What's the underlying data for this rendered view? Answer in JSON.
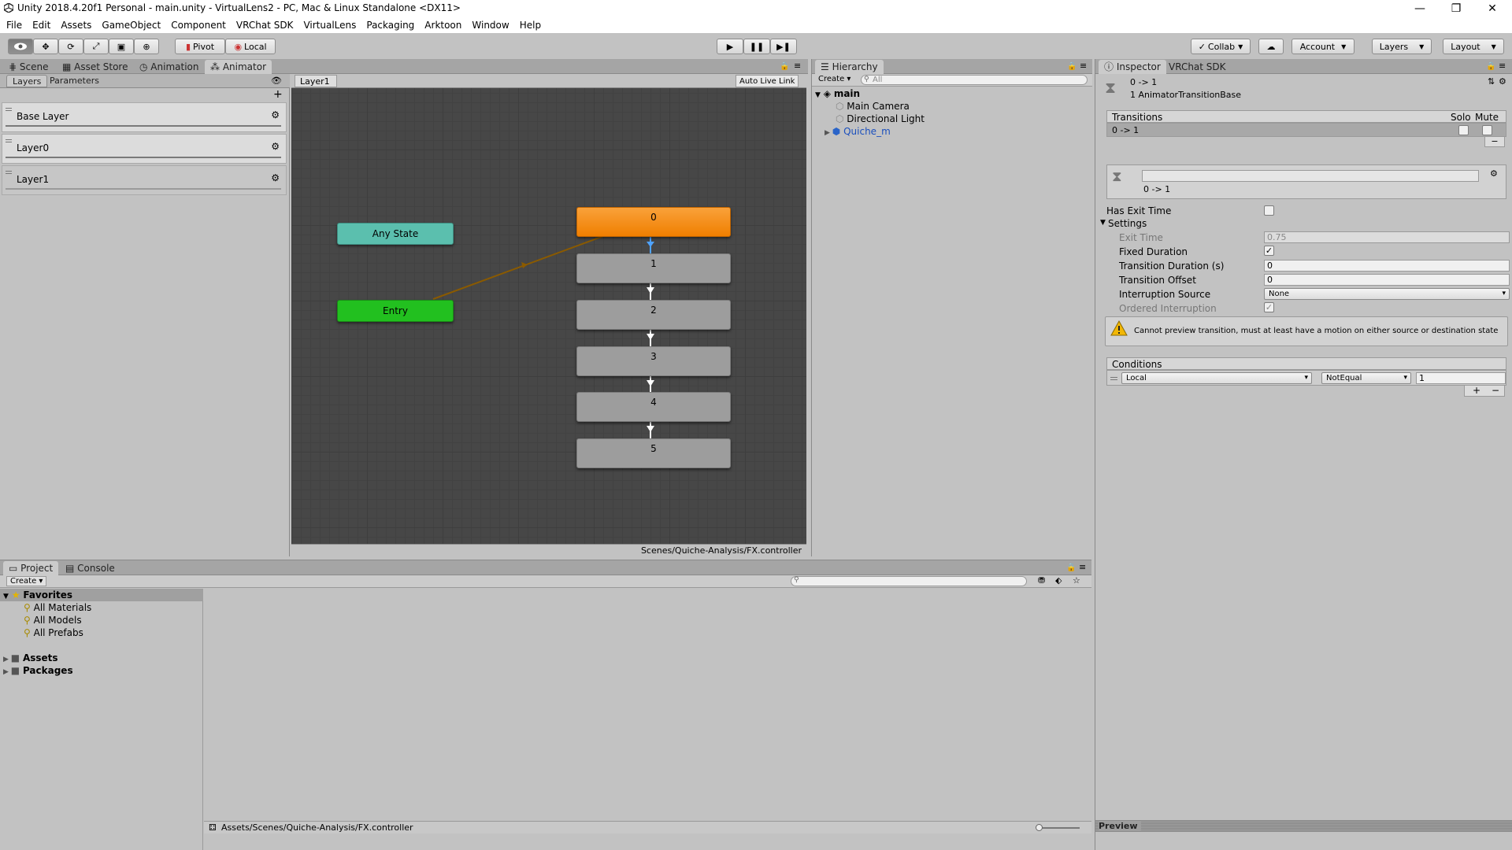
{
  "window": {
    "title": "Unity 2018.4.20f1 Personal - main.unity - VirtualLens2 - PC, Mac & Linux Standalone <DX11>",
    "minimize": "—",
    "maximize": "❐",
    "close": "✕"
  },
  "menu": [
    "File",
    "Edit",
    "Assets",
    "GameObject",
    "Component",
    "VRChat SDK",
    "VirtualLens",
    "Packaging",
    "Arktoon",
    "Window",
    "Help"
  ],
  "toolbar": {
    "pivot": "Pivot",
    "local": "Local",
    "collab": "Collab",
    "account": "Account",
    "layers": "Layers",
    "layout": "Layout"
  },
  "scene_tabs": [
    "Scene",
    "Asset Store",
    "Animation",
    "Animator"
  ],
  "animator": {
    "left_tabs": [
      "Layers",
      "Parameters"
    ],
    "layers": [
      "Base Layer",
      "Layer0",
      "Layer1"
    ],
    "breadcrumb": "Layer1",
    "auto_live_link": "Auto Live Link",
    "footer_path": "Scenes/Quiche-Analysis/FX.controller",
    "any_state": "Any State",
    "entry": "Entry",
    "states": [
      "0",
      "1",
      "2",
      "3",
      "4",
      "5"
    ],
    "colors": {
      "default_state": "#f58a0d",
      "any_state": "#5bbfae",
      "entry": "#22c01f",
      "state": "#9d9d9d",
      "transition_entry": "#8a5a00",
      "transition_selected": "#4fa3ff"
    }
  },
  "hierarchy": {
    "tab": "Hierarchy",
    "create": "Create",
    "search_placeholder": "All",
    "scene": "main",
    "items": [
      "Main Camera",
      "Directional Light",
      "Quiche_m"
    ]
  },
  "inspector": {
    "tabs": [
      "Inspector",
      "VRChat SDK"
    ],
    "header_title": "0 -> 1",
    "header_subtitle": "1 AnimatorTransitionBase",
    "transitions_label": "Transitions",
    "solo": "Solo",
    "mute": "Mute",
    "transition_row": "0 -> 1",
    "sub_title": "0 -> 1",
    "has_exit_time_label": "Has Exit Time",
    "settings_label": "Settings",
    "exit_time_label": "Exit Time",
    "exit_time_value": "0.75",
    "fixed_duration_label": "Fixed Duration",
    "transition_duration_label": "Transition Duration (s)",
    "transition_duration_value": "0",
    "transition_offset_label": "Transition Offset",
    "transition_offset_value": "0",
    "interruption_source_label": "Interruption Source",
    "interruption_source_value": "None",
    "ordered_interruption_label": "Ordered Interruption",
    "warning": "Cannot preview transition, must at least have a motion on either source or destination state",
    "conditions_label": "Conditions",
    "condition": {
      "parameter": "Local",
      "mode": "NotEqual",
      "value": "1"
    },
    "preview_label": "Preview",
    "checks": {
      "has_exit_time": false,
      "fixed_duration": true,
      "ordered_interruption": true
    }
  },
  "project": {
    "tabs": [
      "Project",
      "Console"
    ],
    "create": "Create",
    "favorites": "Favorites",
    "favorite_items": [
      "All Materials",
      "All Models",
      "All Prefabs"
    ],
    "folders": [
      "Assets",
      "Packages"
    ],
    "footer_path": "Assets/Scenes/Quiche-Analysis/FX.controller"
  }
}
